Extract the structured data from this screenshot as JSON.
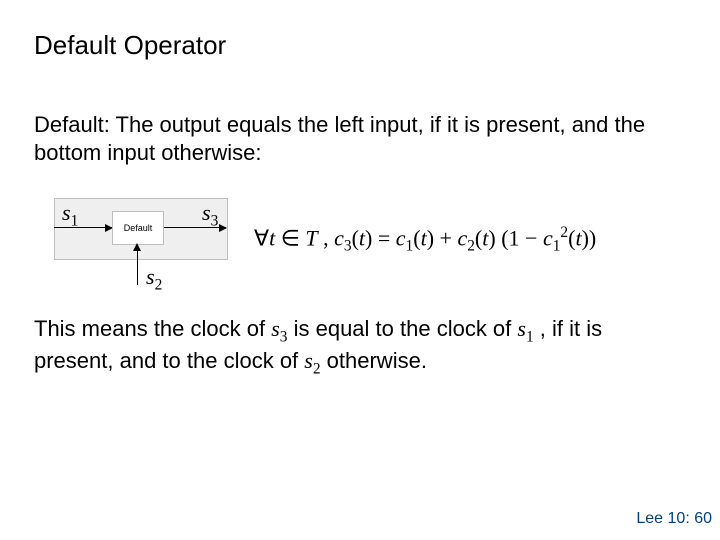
{
  "title": "Default Operator",
  "para1": "Default: The output equals the left input, if it is present, and the bottom input otherwise:",
  "diagram": {
    "box_label": "Default",
    "s1": "s",
    "s1_sub": "1",
    "s3": "s",
    "s3_sub": "3",
    "s2": "s",
    "s2_sub": "2"
  },
  "math": {
    "forall": "∀",
    "t": "t",
    "in": "∈",
    "T": "T",
    "comma": " ,   ",
    "c3": "c",
    "c3_sub": "3",
    "lp": "(",
    "tvar": "t",
    "rp": ")",
    "eq": " = ",
    "c1": "c",
    "c1_sub": "1",
    "plus": " + ",
    "c2": "c",
    "c2_sub": "2",
    "times": "(1 − ",
    "c1b": "c",
    "c1b_sub": "1",
    "sq_sup": "2",
    "end": ")"
  },
  "explain": {
    "pre": "This means the clock of ",
    "s3": "s",
    "s3_sub": "3",
    "mid1": " is equal to the clock of ",
    "s1": "s",
    "s1_sub": "1",
    "mid2": " , if it is present, and to the clock of ",
    "s2": "s",
    "s2_sub": "2",
    "post": " otherwise."
  },
  "footer": "Lee 10: 60"
}
